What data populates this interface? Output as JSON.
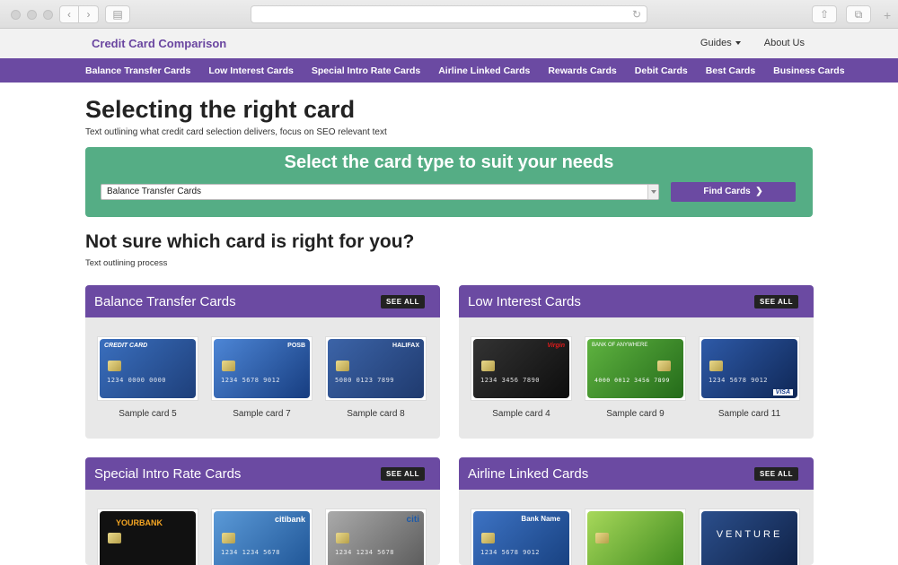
{
  "header": {
    "brand": "Credit Card Comparison",
    "nav": [
      {
        "label": "Guides",
        "has_caret": true
      },
      {
        "label": "About Us",
        "has_caret": false
      }
    ]
  },
  "categories": [
    "Balance Transfer Cards",
    "Low Interest Cards",
    "Special Intro Rate Cards",
    "Airline Linked Cards",
    "Rewards Cards",
    "Debit Cards",
    "Best Cards",
    "Business Cards"
  ],
  "main": {
    "title": "Selecting the right card",
    "subtitle": "Text outlining what credit card selection delivers, focus on SEO relevant text",
    "finder": {
      "title": "Select the card type to suit your needs",
      "selected": "Balance Transfer Cards",
      "button_label": "Find Cards"
    },
    "section_title": "Not sure which card is right for you?",
    "section_sub": "Text outlining process"
  },
  "panels": [
    {
      "title": "Balance Transfer Cards",
      "see_all": "SEE ALL",
      "cards": [
        {
          "caption": "Sample card 5",
          "brand_text": "CREDIT CARD",
          "number": "1234 0000 0000",
          "color": "#2c5aa0"
        },
        {
          "caption": "Sample card 7",
          "brand_text": "POSB",
          "number": "1234 5678 9012",
          "color": "#2a62b8"
        },
        {
          "caption": "Sample card 8",
          "brand_text": "HALIFAX",
          "number": "5000 0123 7899",
          "color": "#2d4f8e"
        }
      ]
    },
    {
      "title": "Low Interest Cards",
      "see_all": "SEE ALL",
      "cards": [
        {
          "caption": "Sample card 4",
          "brand_text": "Virgin",
          "number": "1234 3456 7890",
          "color": "#1a1a1a"
        },
        {
          "caption": "Sample card 9",
          "brand_text": "BANK OF ANYWHERE",
          "number": "4000 0012 3456 7899",
          "color": "#3e8a2a"
        },
        {
          "caption": "Sample card 11",
          "brand_text": "VISA",
          "number": "1234 5678 9012",
          "color": "#1d3c78"
        }
      ]
    },
    {
      "title": "Special Intro Rate Cards",
      "see_all": "SEE ALL",
      "cards": [
        {
          "caption": "",
          "brand_text": "YOURBANK",
          "number": "",
          "color": "#111111"
        },
        {
          "caption": "",
          "brand_text": "citibank",
          "number": "1234 1234 5678",
          "color": "#3573b5"
        },
        {
          "caption": "",
          "brand_text": "citi",
          "number": "1234 1234 5678",
          "color": "#8a8a8a"
        }
      ]
    },
    {
      "title": "Airline Linked Cards",
      "see_all": "SEE ALL",
      "cards": [
        {
          "caption": "",
          "brand_text": "Bank Name",
          "number": "1234 5678 9012",
          "color": "#2a5aa8"
        },
        {
          "caption": "",
          "brand_text": "",
          "number": "",
          "color": "#7ab43a"
        },
        {
          "caption": "",
          "brand_text": "VENTURE",
          "number": "",
          "color": "#1e3566"
        }
      ]
    }
  ],
  "colors": {
    "purple": "#6b4aa2",
    "green": "#55ad85"
  }
}
